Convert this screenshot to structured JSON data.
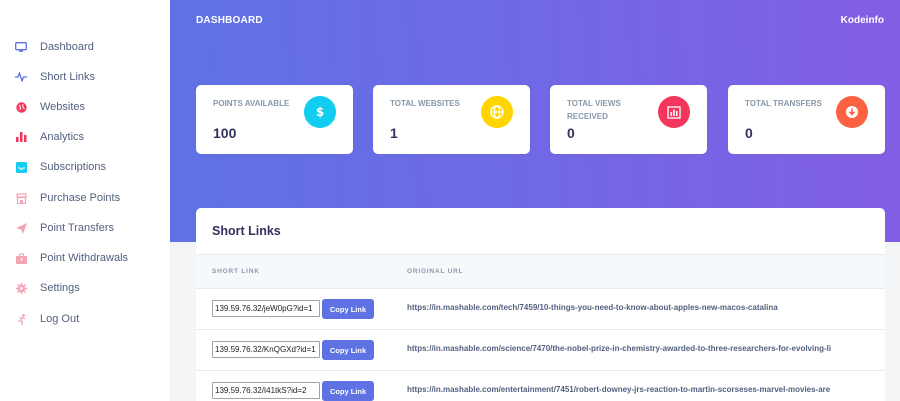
{
  "header": {
    "title": "DASHBOARD",
    "brand": "Kodeinfo"
  },
  "sidebar": {
    "items": [
      {
        "label": "Dashboard",
        "icon": "monitor-icon",
        "color": "#5e72e4"
      },
      {
        "label": "Short Links",
        "icon": "pulse-icon",
        "color": "#5e72e4"
      },
      {
        "label": "Websites",
        "icon": "globe-icon",
        "color": "#f5365c"
      },
      {
        "label": "Analytics",
        "icon": "bar-chart-icon",
        "color": "#f5365c"
      },
      {
        "label": "Subscriptions",
        "icon": "inbox-icon",
        "color": "#11cdef"
      },
      {
        "label": "Purchase Points",
        "icon": "shop-icon",
        "color": "#f3a4b5"
      },
      {
        "label": "Point Transfers",
        "icon": "send-icon",
        "color": "#f3a4b5"
      },
      {
        "label": "Point Withdrawals",
        "icon": "briefcase-icon",
        "color": "#f3a4b5"
      },
      {
        "label": "Settings",
        "icon": "gear-icon",
        "color": "#f3a4b5"
      },
      {
        "label": "Log Out",
        "icon": "run-icon",
        "color": "#f3a4b5"
      }
    ]
  },
  "stats": [
    {
      "label": "POINTS AVAILABLE",
      "value": "100",
      "icon": "dollar-icon",
      "color": "#11cdef"
    },
    {
      "label": "TOTAL WEBSITES",
      "value": "1",
      "icon": "globe-icon",
      "color": "#ffd600"
    },
    {
      "label": "TOTAL VIEWS RECEIVED",
      "value": "0",
      "icon": "chart-icon",
      "color": "#f5365c"
    },
    {
      "label": "TOTAL TRANSFERS",
      "value": "0",
      "icon": "download-icon",
      "color": "#fb6340"
    }
  ],
  "short_links": {
    "title": "Short Links",
    "columns": [
      "SHORT LINK",
      "ORIGINAL URL"
    ],
    "copy_label": "Copy Link",
    "rows": [
      {
        "short": "139.59.76.32/jeW0pG?id=1",
        "original": "https://in.mashable.com/tech/7459/10-things-you-need-to-know-about-apples-new-macos-catalina"
      },
      {
        "short": "139.59.76.32/KnQGXd?id=1",
        "original": "https://in.mashable.com/science/7470/the-nobel-prize-in-chemistry-awarded-to-three-researchers-for-evolving-li"
      },
      {
        "short": "139.59.76.32/I41tkS?id=2",
        "original": "https://in.mashable.com/entertainment/7451/robert-downey-jrs-reaction-to-martin-scorseses-marvel-movies-are"
      }
    ]
  }
}
